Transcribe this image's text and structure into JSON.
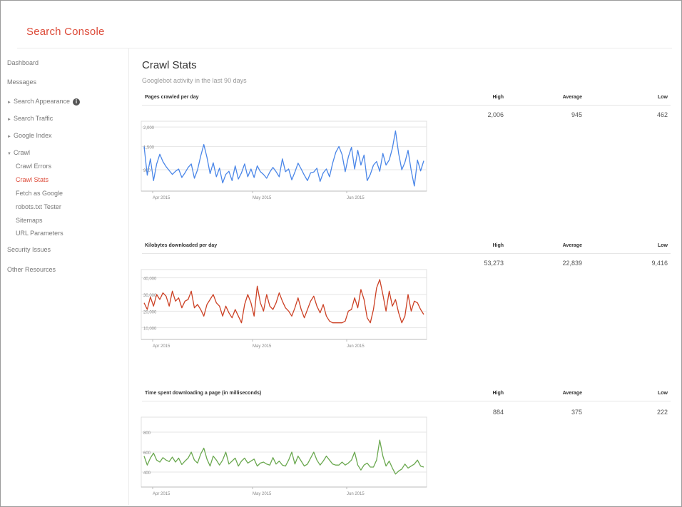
{
  "app": {
    "title": "Search Console"
  },
  "sidebar": {
    "items": [
      {
        "label": "Dashboard"
      },
      {
        "label": "Messages"
      },
      {
        "label": "Search Appearance"
      },
      {
        "label": "Search Traffic"
      },
      {
        "label": "Google Index"
      },
      {
        "label": "Crawl"
      },
      {
        "label": "Crawl Errors"
      },
      {
        "label": "Crawl Stats"
      },
      {
        "label": "Fetch as Google"
      },
      {
        "label": "robots.txt Tester"
      },
      {
        "label": "Sitemaps"
      },
      {
        "label": "URL Parameters"
      },
      {
        "label": "Security Issues"
      },
      {
        "label": "Other Resources"
      }
    ]
  },
  "page": {
    "title": "Crawl Stats",
    "subtitle": "Googlebot activity in the last 90 days"
  },
  "stat_headers": {
    "high": "High",
    "average": "Average",
    "low": "Low"
  },
  "sections": [
    {
      "title": "Pages crawled per day",
      "high": "2,006",
      "average": "945",
      "low": "462"
    },
    {
      "title": "Kilobytes downloaded per day",
      "high": "53,273",
      "average": "22,839",
      "low": "9,416"
    },
    {
      "title": "Time spent downloading a page (in milliseconds)",
      "high": "884",
      "average": "375",
      "low": "222"
    }
  ],
  "colors": {
    "brand": "#dd4b39",
    "pages": "#4a86e8",
    "kilobytes": "#cc4125",
    "time": "#6aa84f"
  },
  "chart_data": [
    {
      "type": "line",
      "title": "Pages crawled per day",
      "x_start": "2015-04-03",
      "x_ticks": [
        "Apr 2015",
        "May 2015",
        "Jun 2015"
      ],
      "y_ticks": [
        "2,000",
        "1,500",
        "900"
      ],
      "ylim": [
        350,
        2150
      ],
      "grid": true,
      "series": [
        {
          "values": [
            1500,
            760,
            1180,
            620,
            1050,
            1300,
            1110,
            980,
            880,
            780,
            860,
            920,
            700,
            820,
            960,
            1050,
            680,
            900,
            1250,
            1550,
            1220,
            800,
            1080,
            720,
            940,
            560,
            780,
            860,
            620,
            1000,
            660,
            820,
            1050,
            720,
            920,
            700,
            1000,
            850,
            780,
            680,
            840,
            960,
            850,
            720,
            1180,
            850,
            920,
            640,
            840,
            1070,
            920,
            760,
            620,
            820,
            840,
            940,
            600,
            820,
            920,
            720,
            1070,
            1350,
            1500,
            1290,
            850,
            1230,
            1480,
            920,
            1400,
            1020,
            1280,
            620,
            780,
            1020,
            1110,
            860,
            1320,
            1020,
            1150,
            1450,
            1900,
            1320,
            900,
            1090,
            1400,
            880,
            480,
            1150,
            870,
            1130
          ]
        }
      ]
    },
    {
      "type": "line",
      "title": "Kilobytes downloaded per day",
      "x_start": "2015-04-03",
      "x_ticks": [
        "Apr 2015",
        "May 2015",
        "Jun 2015"
      ],
      "y_ticks": [
        "40,000",
        "30,000",
        "20,000",
        "10,000"
      ],
      "ylim": [
        3000,
        45000
      ],
      "grid": true,
      "series": [
        {
          "values": [
            25000,
            21000,
            28500,
            23000,
            30000,
            27000,
            31000,
            29000,
            23000,
            32000,
            26000,
            28000,
            22000,
            26000,
            27000,
            32000,
            22000,
            24000,
            21000,
            17000,
            24000,
            27000,
            30000,
            25000,
            23000,
            17000,
            23000,
            19000,
            16000,
            21000,
            17000,
            13000,
            24000,
            30000,
            25000,
            17000,
            35000,
            25000,
            20000,
            30000,
            23000,
            21000,
            25000,
            31000,
            26000,
            22000,
            20000,
            17000,
            22000,
            28000,
            21000,
            16000,
            21000,
            26000,
            29000,
            23000,
            19000,
            24000,
            17000,
            14000,
            13000,
            13000,
            13000,
            13000,
            14000,
            20000,
            21000,
            28000,
            22000,
            33000,
            27000,
            16000,
            13000,
            21000,
            34000,
            39000,
            30000,
            20000,
            32000,
            23000,
            27000,
            19000,
            13000,
            17000,
            30000,
            20000,
            26000,
            25000,
            21000,
            18000
          ]
        }
      ]
    },
    {
      "type": "line",
      "title": "Time spent downloading a page (in milliseconds)",
      "x_start": "2015-04-03",
      "x_ticks": [
        "Apr 2015",
        "May 2015",
        "Jun 2015"
      ],
      "y_ticks": [
        "800",
        "600",
        "400"
      ],
      "ylim": [
        250,
        950
      ],
      "grid": true,
      "series": [
        {
          "values": [
            560,
            470,
            540,
            590,
            520,
            500,
            545,
            520,
            505,
            550,
            500,
            540,
            475,
            510,
            540,
            600,
            520,
            490,
            580,
            640,
            530,
            460,
            560,
            520,
            470,
            520,
            600,
            480,
            510,
            540,
            460,
            510,
            540,
            490,
            510,
            530,
            460,
            490,
            500,
            480,
            470,
            545,
            480,
            510,
            470,
            460,
            520,
            600,
            480,
            560,
            510,
            460,
            480,
            540,
            600,
            520,
            470,
            510,
            560,
            520,
            480,
            470,
            470,
            500,
            470,
            490,
            520,
            600,
            470,
            420,
            470,
            490,
            450,
            450,
            520,
            720,
            560,
            460,
            510,
            440,
            380,
            410,
            430,
            480,
            440,
            460,
            480,
            520,
            460,
            450
          ]
        }
      ]
    }
  ]
}
